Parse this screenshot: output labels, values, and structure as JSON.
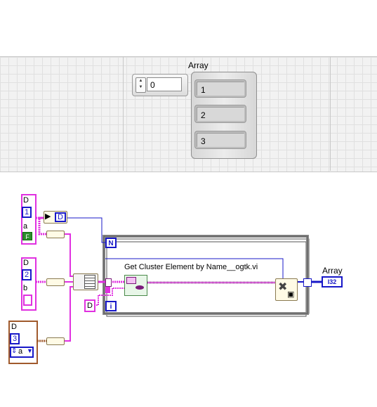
{
  "front_panel": {
    "array_label": "Array",
    "index_value": "0",
    "elements": [
      "1",
      "2",
      "3"
    ]
  },
  "block_diagram": {
    "clusters": [
      {
        "name_top": "D",
        "number": "1",
        "name_elem": "a",
        "bool": "F"
      },
      {
        "name_top": "D",
        "number": "2",
        "name_elem": "b"
      },
      {
        "name_top": "D",
        "number": "3",
        "enum_value": "a"
      }
    ],
    "unbundle_label": "D",
    "for_loop": {
      "count_terminal": "N",
      "iteration_terminal": "i"
    },
    "subvi_label": "Get Cluster Element by Name__ogtk.vi",
    "constant_label": "D",
    "output": {
      "label": "Array",
      "type": "I32"
    },
    "colors": {
      "cluster_wire": "#e030e0",
      "numeric_wire": "#1818c8",
      "cluster_border_alt": "#a05a2c"
    }
  }
}
